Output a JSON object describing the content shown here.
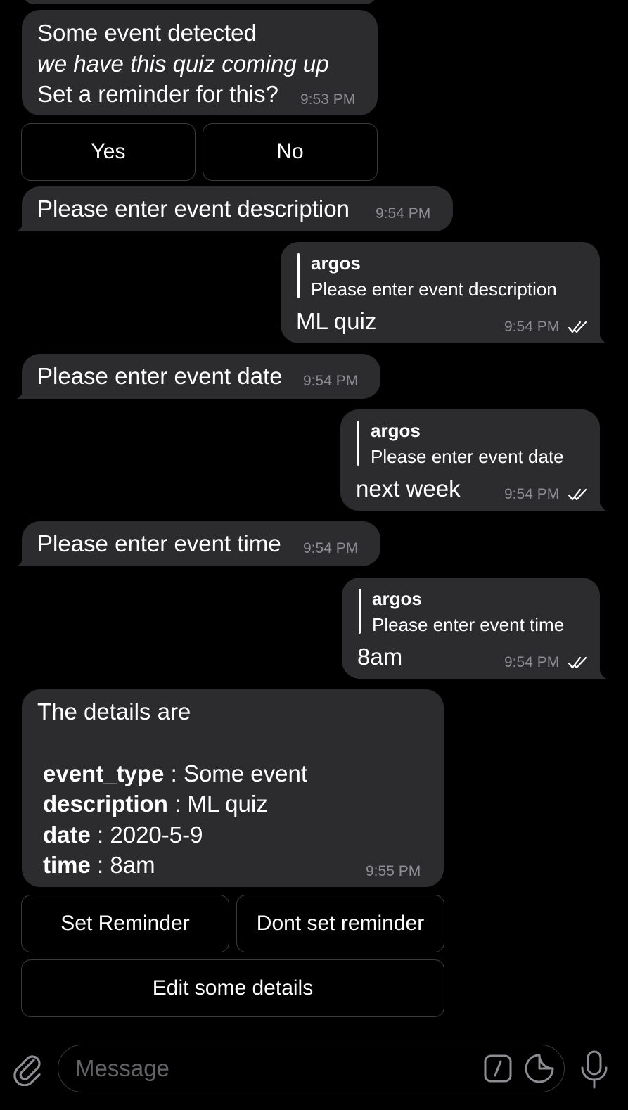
{
  "messages": {
    "m1": {
      "line1": "Some event detected",
      "line2": "we have this quiz coming up",
      "line3": "Set a reminder for this?",
      "time": "9:53 PM"
    },
    "kb1": {
      "yes": "Yes",
      "no": "No"
    },
    "m2": {
      "text": "Please enter event description",
      "time": "9:54 PM"
    },
    "r1": {
      "reply_name": "argos",
      "reply_text": "Please enter event description",
      "text": "ML quiz",
      "time": "9:54 PM"
    },
    "m3": {
      "text": "Please enter event date",
      "time": "9:54 PM"
    },
    "r2": {
      "reply_name": "argos",
      "reply_text": "Please enter event date",
      "text": "next week",
      "time": "9:54 PM"
    },
    "m4": {
      "text": "Please enter event time",
      "time": "9:54 PM"
    },
    "r3": {
      "reply_name": "argos",
      "reply_text": "Please enter event time",
      "text": "8am",
      "time": "9:54 PM"
    },
    "m5": {
      "header": "The details are",
      "rows": [
        {
          "key": "event_type",
          "sep": " : ",
          "value": "Some event"
        },
        {
          "key": "description",
          "sep": " : ",
          "value": "ML quiz"
        },
        {
          "key": "date",
          "sep": " : ",
          "value": "2020-5-9"
        },
        {
          "key": "time",
          "sep": " : ",
          "value": "8am"
        }
      ],
      "time": "9:55 PM"
    },
    "kb2": {
      "set": "Set Reminder",
      "dont": "Dont set reminder",
      "edit": "Edit some details"
    }
  },
  "composer": {
    "placeholder": "Message",
    "icons": [
      "paperclip-icon",
      "bot-command-icon",
      "sticker-icon",
      "microphone-icon"
    ]
  },
  "colors": {
    "background": "#000000",
    "bubble": "#2c2c2e",
    "time": "#8d8d93"
  }
}
